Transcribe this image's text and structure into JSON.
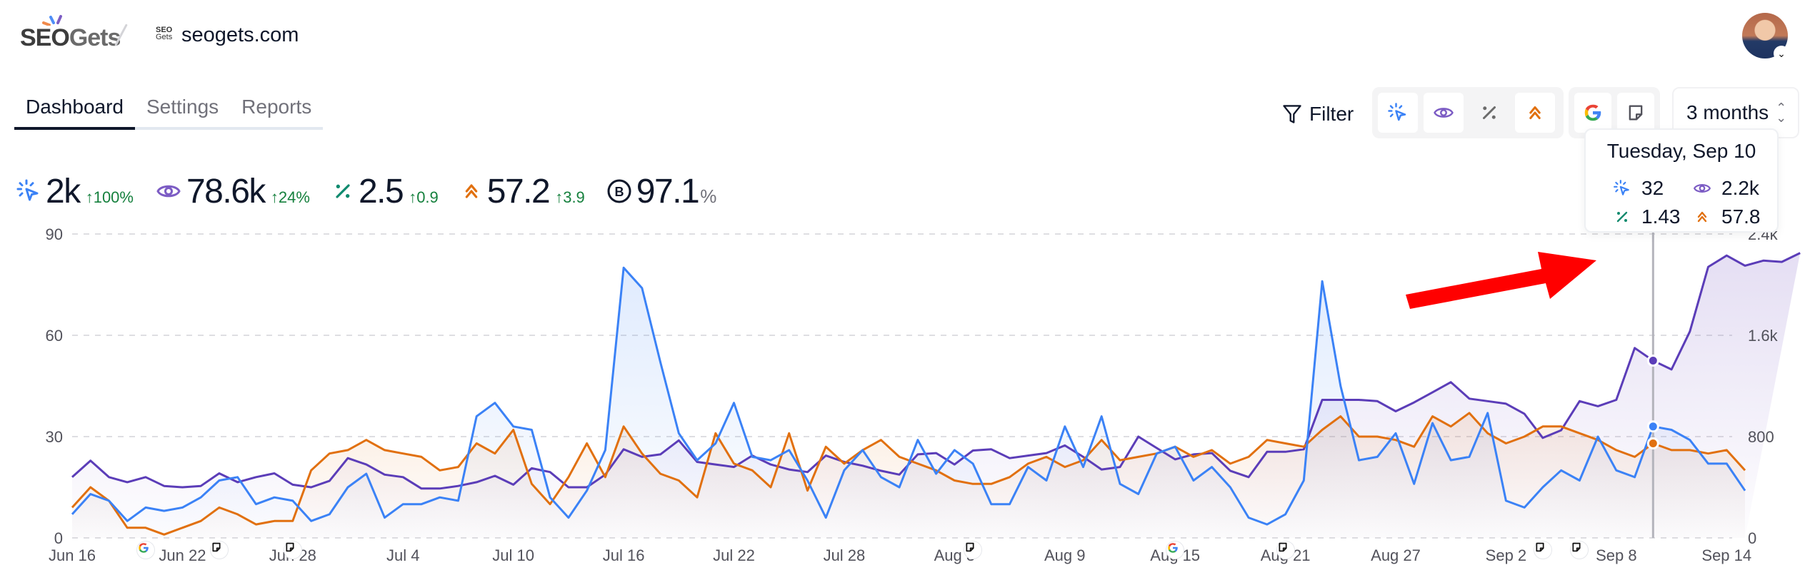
{
  "header": {
    "brand": {
      "part1": "SEO",
      "part2": "Gets"
    },
    "site_icon_text": [
      "SEO",
      "Gets"
    ],
    "site_name": "seogets.com",
    "avatar_alt": "user avatar"
  },
  "tabs": [
    {
      "label": "Dashboard",
      "active": true
    },
    {
      "label": "Settings",
      "active": false
    },
    {
      "label": "Reports",
      "active": false
    }
  ],
  "toolbar": {
    "filter_label": "Filter",
    "metric_toggles": [
      {
        "name": "clicks",
        "icon": "cursor-click-icon",
        "active": true
      },
      {
        "name": "impressions",
        "icon": "eye-icon",
        "active": true
      },
      {
        "name": "ctr",
        "icon": "percent-icon",
        "active": false
      },
      {
        "name": "position",
        "icon": "chevrons-up-icon",
        "active": true
      }
    ],
    "annotation_toggles": [
      {
        "name": "google-updates",
        "icon": "google-icon",
        "active": true
      },
      {
        "name": "notes",
        "icon": "note-icon",
        "active": true
      }
    ],
    "range_value": "3 months"
  },
  "metrics": [
    {
      "name": "clicks",
      "value": "2k",
      "delta": "↑100%",
      "color": "#3b82f6"
    },
    {
      "name": "impressions",
      "value": "78.6k",
      "delta": "↑24%",
      "color": "#7c5cc4"
    },
    {
      "name": "ctr",
      "value": "2.5",
      "delta": "↑0.9",
      "color": "#0f8a6e"
    },
    {
      "name": "position",
      "value": "57.2",
      "delta": "↑3.9",
      "color": "#e1700f"
    },
    {
      "name": "branded",
      "value": "97.1",
      "unit": "%",
      "color": "#0f172a"
    }
  ],
  "tooltip": {
    "date": "Tuesday, Sep 10",
    "clicks": "32",
    "impressions": "2.2k",
    "ctr": "1.43",
    "position": "57.8"
  },
  "colors": {
    "clicks": "#3b82f6",
    "impressions": "#5b3db8",
    "position": "#e1700f",
    "ctr": "#0f8a6e",
    "arrow": "#ff0000"
  },
  "chart_data": {
    "type": "line",
    "title": "",
    "x_start": "Jun 16",
    "x_end": "Sep 14",
    "x_tick_labels": [
      "Jun 16",
      "Jun 22",
      "Jun 28",
      "Jul 4",
      "Jul 10",
      "Jul 16",
      "Jul 22",
      "Jul 28",
      "Aug 3",
      "Aug 9",
      "Aug 15",
      "Aug 21",
      "Aug 27",
      "Sep 2",
      "Sep 8",
      "Sep 14"
    ],
    "y_left": {
      "ticks": [
        "0",
        "30",
        "60",
        "90"
      ],
      "range": [
        0,
        90
      ],
      "label": "Clicks"
    },
    "y_right": {
      "ticks": [
        "0",
        "800",
        "1.6k",
        "2.4k"
      ],
      "range": [
        0,
        2400
      ],
      "label": "Impressions"
    },
    "grid": true,
    "highlight_index": 86,
    "series": [
      {
        "name": "Clicks",
        "axis": "left",
        "color": "#3b82f6",
        "values": [
          7,
          13,
          11,
          5,
          9,
          8,
          9,
          12,
          17,
          18,
          10,
          12,
          11,
          5,
          7,
          15,
          19,
          6,
          10,
          10,
          12,
          11,
          36,
          40,
          33,
          32,
          12,
          6,
          14,
          26,
          80,
          74,
          52,
          31,
          23,
          28,
          40,
          24,
          23,
          26,
          17,
          6,
          20,
          26,
          18,
          15,
          29,
          19,
          26,
          22,
          10,
          10,
          21,
          17,
          33,
          21,
          36,
          16,
          13,
          25,
          27,
          17,
          21,
          15,
          6,
          4,
          7,
          17,
          76,
          45,
          23,
          24,
          31,
          16,
          34,
          23,
          24,
          37,
          11,
          9,
          15,
          20,
          17,
          30,
          20,
          18,
          33,
          32,
          29,
          22,
          22,
          14
        ],
        "notes": "values aligned by day from Jun 16 to Sep 14"
      },
      {
        "name": "Impressions",
        "axis": "right",
        "color": "#5b3db8",
        "values": [
          480,
          610,
          480,
          440,
          480,
          410,
          400,
          410,
          510,
          440,
          480,
          510,
          420,
          400,
          450,
          630,
          580,
          500,
          480,
          390,
          390,
          410,
          440,
          490,
          420,
          550,
          520,
          400,
          400,
          500,
          700,
          640,
          660,
          770,
          600,
          580,
          560,
          650,
          580,
          540,
          520,
          650,
          600,
          570,
          530,
          500,
          660,
          670,
          580,
          690,
          700,
          630,
          650,
          670,
          730,
          640,
          540,
          560,
          800,
          710,
          620,
          660,
          670,
          530,
          480,
          680,
          680,
          700,
          1090,
          1090,
          1090,
          1080,
          1000,
          1070,
          1150,
          1230,
          1100,
          1080,
          1060,
          980,
          790,
          850,
          1080,
          1040,
          1090,
          1500,
          1400,
          1330,
          1630,
          2140,
          2230,
          2150,
          2190,
          2180,
          2250
        ]
      },
      {
        "name": "Position",
        "axis": "left",
        "color": "#e1700f",
        "values": [
          9,
          15,
          11,
          3,
          3,
          1,
          3,
          5,
          9,
          7,
          4,
          5,
          5,
          20,
          25,
          26,
          29,
          26,
          25,
          24,
          20,
          21,
          28,
          25,
          32,
          16,
          10,
          18,
          28,
          18,
          33,
          25,
          19,
          17,
          12,
          31,
          22,
          20,
          15,
          31,
          14,
          27,
          22,
          26,
          29,
          24,
          22,
          20,
          17,
          16,
          16,
          18,
          22,
          24,
          21,
          23,
          29,
          23,
          24,
          25,
          27,
          24,
          26,
          22,
          24,
          29,
          28,
          27,
          32,
          36,
          30,
          30,
          29,
          27,
          36,
          33,
          37,
          31,
          28,
          30,
          33,
          33,
          31,
          29,
          26,
          24,
          28,
          26,
          26,
          25,
          26,
          20
        ]
      }
    ],
    "event_markers": [
      {
        "type": "google-update",
        "date": "Jun 20"
      },
      {
        "type": "note",
        "date": "Jun 24"
      },
      {
        "type": "note",
        "date": "Jun 28"
      },
      {
        "type": "note",
        "date": "Aug 4"
      },
      {
        "type": "google-update",
        "date": "Aug 15"
      },
      {
        "type": "note",
        "date": "Aug 21"
      },
      {
        "type": "note",
        "date": "Sep 4"
      },
      {
        "type": "note",
        "date": "Sep 6"
      }
    ]
  }
}
